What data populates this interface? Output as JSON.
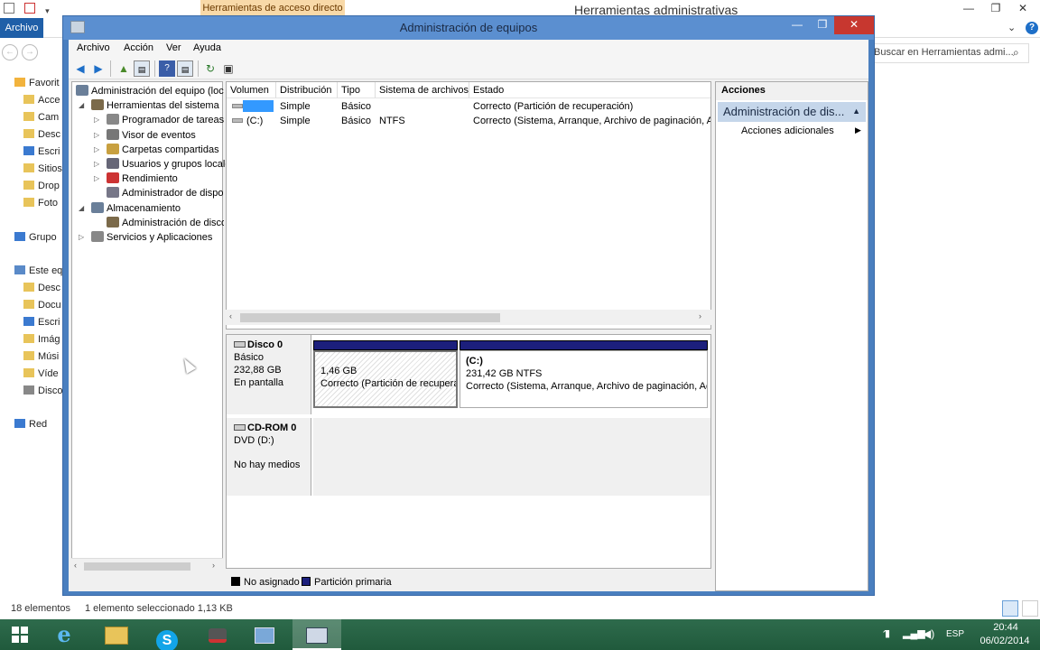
{
  "explorer": {
    "window_title": "Herramientas administrativas",
    "ribbon_context_tab": "Herramientas de acceso directo",
    "archivo_tab": "Archivo",
    "search_placeholder": "Buscar en Herramientas admi...",
    "sidebar": [
      {
        "label": "Favorit",
        "icon": "star-icon"
      },
      {
        "label": "Acce",
        "icon": "folder-icon"
      },
      {
        "label": "Cam",
        "icon": "folder-icon"
      },
      {
        "label": "Desc",
        "icon": "folder-icon"
      },
      {
        "label": "Escri",
        "icon": "desktop-icon"
      },
      {
        "label": "Sitios",
        "icon": "folder-icon"
      },
      {
        "label": "Drop",
        "icon": "folder-icon"
      },
      {
        "label": "Foto",
        "icon": "folder-icon"
      },
      {
        "label": "Grupo",
        "icon": "homegroup-icon"
      },
      {
        "label": "Este eq",
        "icon": "computer-icon"
      },
      {
        "label": "Desc",
        "icon": "folder-icon"
      },
      {
        "label": "Docu",
        "icon": "folder-icon"
      },
      {
        "label": "Escri",
        "icon": "desktop-icon"
      },
      {
        "label": "Imág",
        "icon": "folder-icon"
      },
      {
        "label": "Músi",
        "icon": "folder-icon"
      },
      {
        "label": "Víde",
        "icon": "folder-icon"
      },
      {
        "label": "Disco",
        "icon": "drive-icon"
      },
      {
        "label": "Red",
        "icon": "network-icon"
      }
    ],
    "status": {
      "count": "18 elementos",
      "selection": "1 elemento seleccionado  1,13 KB"
    }
  },
  "cm": {
    "title": "Administración de equipos",
    "menu": [
      "Archivo",
      "Acción",
      "Ver",
      "Ayuda"
    ],
    "tree": [
      {
        "label": "Administración del equipo (loc",
        "level": 0,
        "twisty": ""
      },
      {
        "label": "Herramientas del sistema",
        "level": 1,
        "twisty": "◢"
      },
      {
        "label": "Programador de tareas",
        "level": 2,
        "twisty": "▷"
      },
      {
        "label": "Visor de eventos",
        "level": 2,
        "twisty": "▷"
      },
      {
        "label": "Carpetas compartidas",
        "level": 2,
        "twisty": "▷"
      },
      {
        "label": "Usuarios y grupos locale",
        "level": 2,
        "twisty": "▷"
      },
      {
        "label": "Rendimiento",
        "level": 2,
        "twisty": "▷"
      },
      {
        "label": "Administrador de dispo",
        "level": 2,
        "twisty": ""
      },
      {
        "label": "Almacenamiento",
        "level": 1,
        "twisty": "◢"
      },
      {
        "label": "Administración de disco",
        "level": 2,
        "twisty": ""
      },
      {
        "label": "Servicios y Aplicaciones",
        "level": 1,
        "twisty": "▷"
      }
    ],
    "columns": [
      "Volumen",
      "Distribución",
      "Tipo",
      "Sistema de archivos",
      "Estado"
    ],
    "rows": [
      {
        "volumen": "",
        "distribucion": "Simple",
        "tipo": "Básico",
        "sistema": "",
        "estado": "Correcto (Partición de recuperación)"
      },
      {
        "volumen": "(C:)",
        "distribucion": "Simple",
        "tipo": "Básico",
        "sistema": "NTFS",
        "estado": "Correcto (Sistema, Arranque, Archivo de paginación, Ac"
      }
    ],
    "disks": [
      {
        "name": "Disco 0",
        "type": "Básico",
        "size": "232,88 GB",
        "state": "En pantalla"
      },
      {
        "name": "CD-ROM 0",
        "type": "DVD (D:)",
        "size": "",
        "state": "No hay medios"
      }
    ],
    "partitions": [
      {
        "letter": "",
        "size": "1,46 GB",
        "status": "Correcto (Partición de recupera"
      },
      {
        "letter": "(C:)",
        "size": "231,42 GB NTFS",
        "status": "Correcto (Sistema, Arranque, Archivo de paginación, Ac"
      }
    ],
    "legend": [
      {
        "label": "No asignado",
        "color": "#000000"
      },
      {
        "label": "Partición primaria",
        "color": "#1c1f7c"
      }
    ],
    "actions": {
      "header": "Acciones",
      "section": "Administración de dis...",
      "more": "Acciones adicionales"
    }
  },
  "taskbar": {
    "time": "20:44",
    "date": "06/02/2014",
    "lang": "ESP"
  }
}
